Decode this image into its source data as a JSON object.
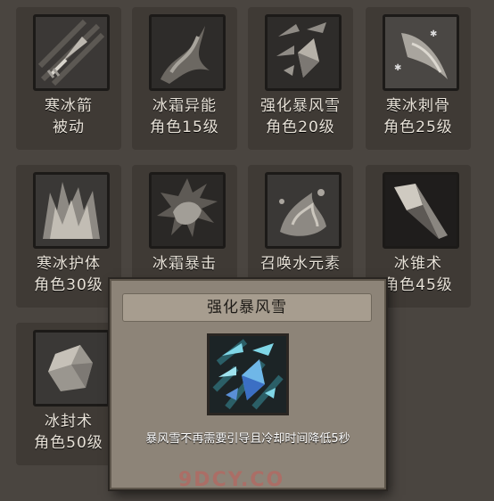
{
  "skills": [
    {
      "name": "寒冰箭",
      "req": "被动",
      "icon": "ice-arrow-icon"
    },
    {
      "name": "冰霜异能",
      "req": "角色15级",
      "icon": "frost-power-icon"
    },
    {
      "name": "强化暴风雪",
      "req": "角色20级",
      "icon": "blizzard-icon"
    },
    {
      "name": "寒冰刺骨",
      "req": "角色25级",
      "icon": "ice-pierce-icon"
    },
    {
      "name": "寒冰护体",
      "req": "角色30级",
      "icon": "ice-armor-icon"
    },
    {
      "name": "冰霜暴击",
      "req": "",
      "icon": "frost-crit-icon"
    },
    {
      "name": "召唤水元素",
      "req": "",
      "icon": "water-elemental-icon"
    },
    {
      "name": "冰锥术",
      "req": "角色45级",
      "icon": "ice-cone-icon"
    },
    {
      "name": "冰封术",
      "req": "角色50级",
      "icon": "ice-block-icon"
    }
  ],
  "popup": {
    "title": "强化暴风雪",
    "description": "暴风雪不再需要引导且冷却时间降低5秒",
    "icon": "blizzard-crystal-icon",
    "accent": "#7fd6e6"
  },
  "watermark": "9DCY.CO"
}
